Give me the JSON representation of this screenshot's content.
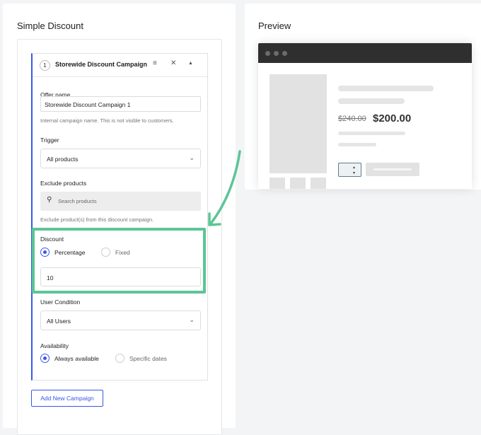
{
  "left_panel": {
    "title": "Simple Discount",
    "campaign": {
      "number": "1",
      "title": "Storewide Discount Campaign 1",
      "icons": [
        "menu-icon",
        "close-icon",
        "collapse-up-icon"
      ],
      "offer_name": {
        "label": "Offer name",
        "value": "Storewide Discount Campaign 1",
        "help": "Internal campaign name. This is not visible to customers."
      },
      "trigger": {
        "label": "Trigger",
        "selected": "All products"
      },
      "exclude_products": {
        "label": "Exclude products",
        "placeholder": "Search products",
        "help": "Exclude product(s) from this discount campaign."
      },
      "discount": {
        "label": "Discount",
        "options": [
          {
            "label": "Percentage",
            "selected": true
          },
          {
            "label": "Fixed",
            "selected": false
          }
        ],
        "value": "10"
      },
      "user_condition": {
        "label": "User Condition",
        "selected": "All Users"
      },
      "availability": {
        "label": "Availability",
        "options": [
          {
            "label": "Always available",
            "selected": true
          },
          {
            "label": "Specific dates",
            "selected": false
          }
        ]
      }
    },
    "add_button": "Add New Campaign"
  },
  "right_panel": {
    "title": "Preview",
    "preview": {
      "old_price": "$240.00",
      "new_price": "$200.00"
    }
  },
  "colors": {
    "accent": "#3858e9",
    "highlight": "#5cc596",
    "browser_bar": "#2f2f2f"
  }
}
